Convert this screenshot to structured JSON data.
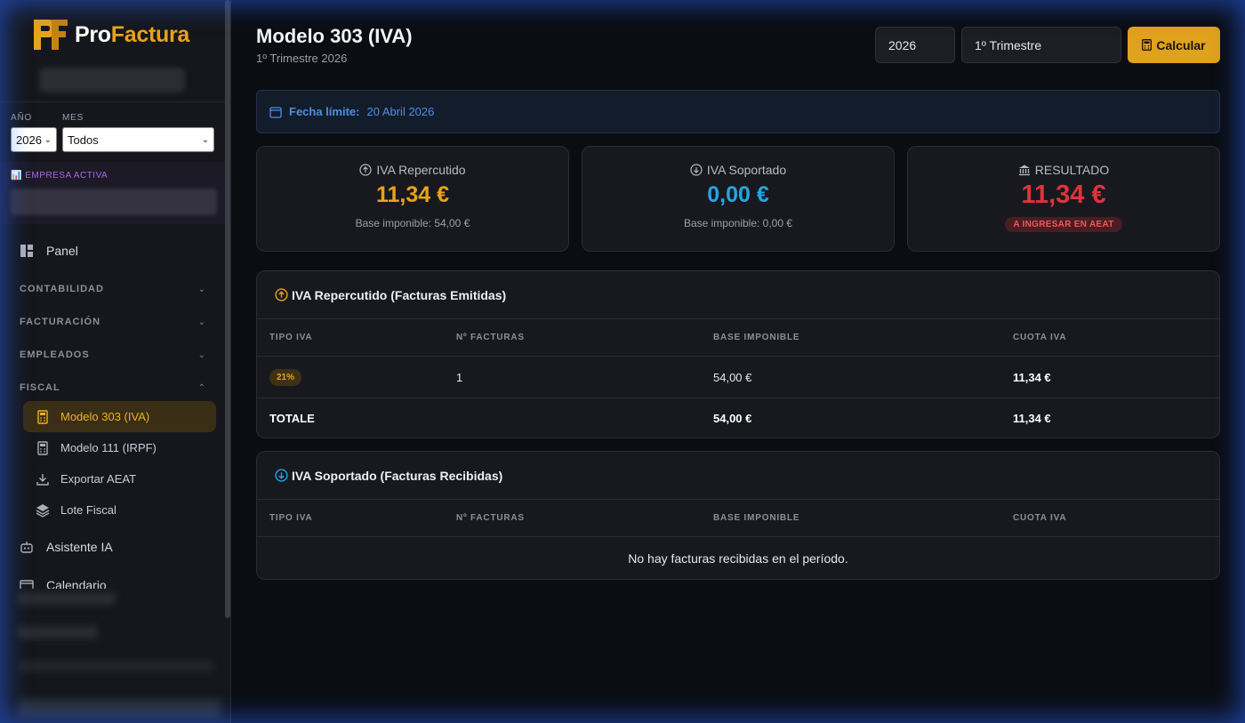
{
  "brand": {
    "pro": "Pro",
    "factura": "Factura"
  },
  "filters": {
    "year_label": "AÑO",
    "year_value": "2026",
    "month_label": "MES",
    "month_value": "Todos"
  },
  "empresa": {
    "label": "EMPRESA ACTIVA"
  },
  "nav": {
    "panel": "Panel",
    "sections": {
      "contabilidad": "CONTABILIDAD",
      "facturacion": "FACTURACIÓN",
      "empleados": "EMPLEADOS",
      "fiscal": "FISCAL"
    },
    "fiscal_items": [
      "Modelo 303 (IVA)",
      "Modelo 111 (IRPF)",
      "Exportar AEAT",
      "Lote Fiscal"
    ],
    "asistente": "Asistente IA",
    "calendario": "Calendario"
  },
  "header": {
    "title": "Modelo 303 (IVA)",
    "subtitle": "1º Trimestre 2026",
    "year_input": "2026",
    "quarter_select": "1º Trimestre",
    "calc_button": "Calcular"
  },
  "deadline": {
    "label": "Fecha límite:",
    "value": "20 Abril 2026"
  },
  "summary": {
    "repercutido": {
      "title": "IVA Repercutido",
      "value": "11,34 €",
      "base": "Base imponible: 54,00 €"
    },
    "soportado": {
      "title": "IVA Soportado",
      "value": "0,00 €",
      "base": "Base imponible: 0,00 €"
    },
    "resultado": {
      "title": "RESULTADO",
      "value": "11,34 €",
      "badge": "A INGRESAR EN AEAT"
    }
  },
  "table_headers": {
    "tipo": "TIPO IVA",
    "facturas": "Nº FACTURAS",
    "base": "BASE IMPONIBLE",
    "cuota": "CUOTA IVA"
  },
  "emitidas": {
    "title": "IVA Repercutido (Facturas Emitidas)",
    "rows": [
      {
        "tipo": "21%",
        "facturas": "1",
        "base": "54,00 €",
        "cuota": "11,34 €"
      }
    ],
    "total": {
      "label": "TOTALE",
      "base": "54,00 €",
      "cuota": "11,34 €"
    }
  },
  "recibidas": {
    "title": "IVA Soportado (Facturas Recibidas)",
    "empty": "No hay facturas recibidas en el período."
  },
  "colors": {
    "accent": "#e0a11c",
    "blue": "#22a6e6",
    "red": "#e0323c",
    "link": "#4d8fe0"
  }
}
